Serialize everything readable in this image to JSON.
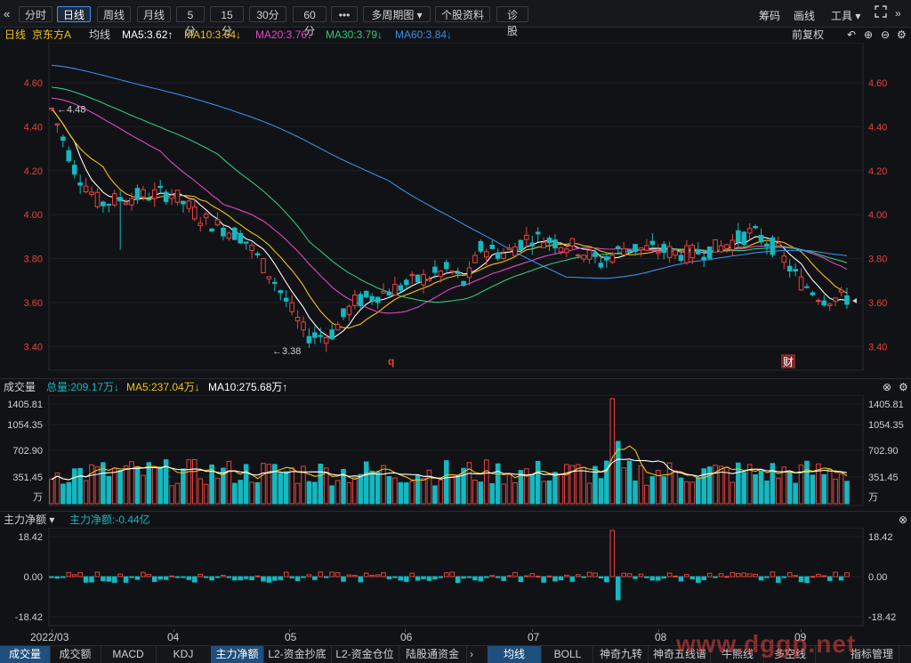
{
  "toolbar": {
    "collapse_icon": "«",
    "buttons": [
      "分时",
      "日线",
      "周线",
      "月线",
      "5分",
      "15分",
      "30分",
      "60分",
      "•••",
      "多周期图 ▾",
      "个股资料",
      "诊股"
    ],
    "active": "日线",
    "right": {
      "chips": "筹码",
      "draw": "画线",
      "tools": "工具 ▾"
    }
  },
  "ma_line": {
    "period": "日线",
    "name": "京东方A",
    "label": "均线",
    "ma5": "MA5:3.62↑",
    "ma10": "MA10:3.64↓",
    "ma20": "MA20:3.76↓",
    "ma30": "MA30:3.79↓",
    "ma60": "MA60:3.84↓",
    "adjust": "前复权"
  },
  "colors": {
    "ma5": "#ffffff",
    "ma10": "#f2c211",
    "ma20": "#e048c8",
    "ma30": "#2fc97a",
    "ma60": "#3a8ee6",
    "up": "#e8423f",
    "down": "#15b8c0"
  },
  "price_axis": {
    "ticks": [
      "4.60",
      "4.40",
      "4.20",
      "4.00",
      "3.80",
      "3.60",
      "3.40"
    ],
    "high_label": "4.48",
    "low_label": "←3.38",
    "q_marker": "q",
    "fin_marker": "财"
  },
  "volume": {
    "title": "成交量",
    "total": "总量:209.17万↓",
    "ma5": "MA5:237.04万↓",
    "ma10": "MA10:275.68万↑",
    "ticks": [
      "1405.81",
      "1054.35",
      "702.90",
      "351.45",
      "万"
    ]
  },
  "netflow": {
    "title": "主力净额 ▾",
    "value": "主力净额:-0.44亿",
    "ticks": [
      "18.42",
      "0.00",
      "-18.42"
    ]
  },
  "date_axis": [
    "2022/03",
    "04",
    "05",
    "06",
    "07",
    "08",
    "09"
  ],
  "bottom_tabs": [
    "成交量",
    "成交额",
    "MACD",
    "KDJ",
    "主力净额",
    "L2-资金抄底",
    "L2-资金仓位",
    "陆股通资金"
  ],
  "bottom_tabs_right": [
    "均线",
    "BOLL",
    "神奇九转",
    "神奇五线谱",
    "牛熊线",
    "多空线",
    "指标管理"
  ],
  "bottom_active": [
    "成交量",
    "主力净额",
    "均线"
  ],
  "watermark": "www.dggp.net"
}
